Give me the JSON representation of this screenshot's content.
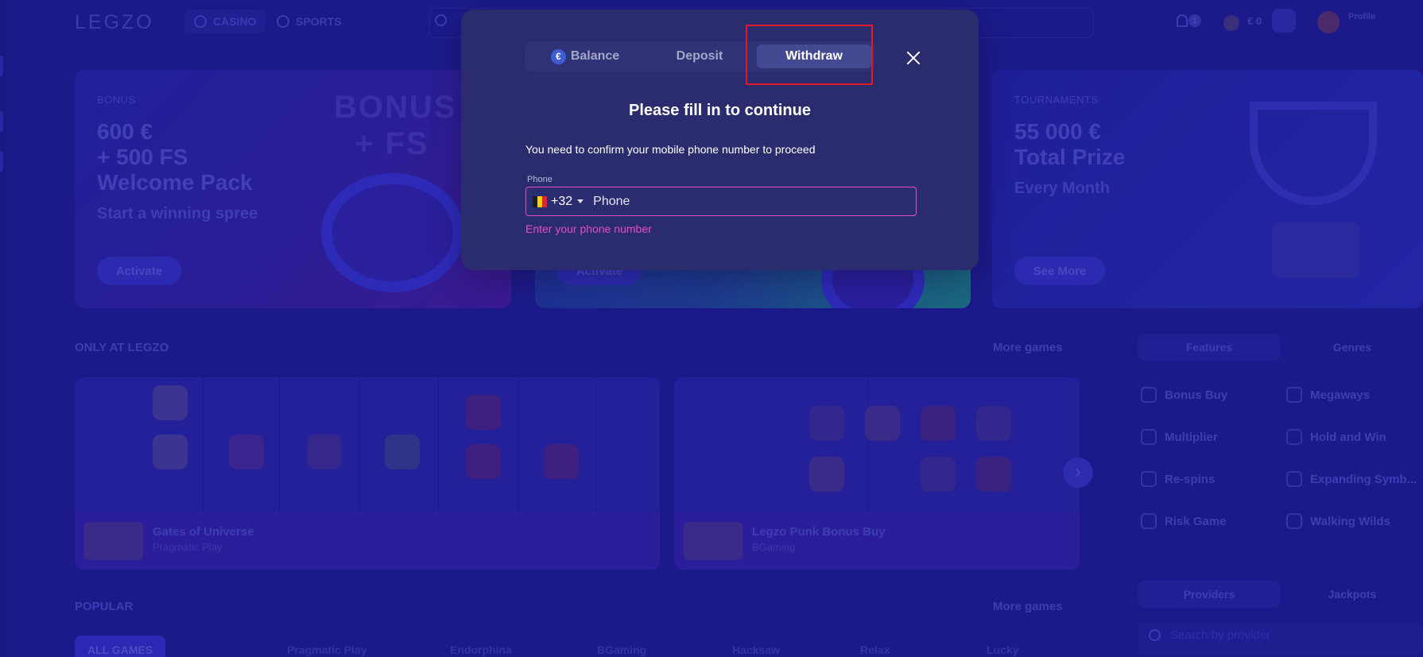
{
  "header": {
    "logo": "LEGZO",
    "nav": [
      {
        "label": "CASINO",
        "icon": "casino-icon"
      },
      {
        "label": "SPORTS",
        "icon": "sports-icon"
      }
    ],
    "notifications_count": "1",
    "balance": "€ 0",
    "profile_label": "Profile"
  },
  "promos": [
    {
      "tag": "BONUS",
      "headline_1": "600 €",
      "headline_2": "+ 500 FS",
      "headline_3": "Welcome Pack",
      "sub": "Start a winning spree",
      "button": "Activate",
      "art": "BONUS",
      "art2": "+ FS"
    },
    {
      "button": "Activate"
    },
    {
      "tag": "TOURNAMENTS",
      "headline_1": "55 000 €",
      "headline_2": "Total Prize",
      "sub": "Every Month",
      "button": "See More"
    }
  ],
  "only_at": {
    "title": "ONLY AT LEGZO",
    "more": "More games",
    "games": [
      {
        "name": "Gates of Universe",
        "provider": "Pragmatic Play"
      },
      {
        "name": "Legzo Punk Bonus Buy",
        "provider": "BGaming"
      }
    ]
  },
  "sidebar": {
    "tabs": [
      "Features",
      "Genres"
    ],
    "features": [
      {
        "label": "Bonus Buy",
        "icon": "bonus-buy-icon"
      },
      {
        "label": "Megaways",
        "icon": "megaways-icon"
      },
      {
        "label": "Multiplier",
        "icon": "diamond-icon"
      },
      {
        "label": "Hold and Win",
        "icon": "dollar-icon"
      },
      {
        "label": "Re-spins",
        "icon": "respin-icon"
      },
      {
        "label": "Expanding Symb...",
        "icon": "expand-icon"
      },
      {
        "label": "Risk Game",
        "icon": "lightning-icon"
      },
      {
        "label": "Walking Wilds",
        "icon": "wilds-icon"
      }
    ],
    "tabs2": [
      "Providers",
      "Jackpots"
    ],
    "provider_search_placeholder": "Search by provider"
  },
  "popular": {
    "title": "POPULAR",
    "more": "More games",
    "chips": [
      "ALL GAMES",
      "Pragmatic Play",
      "Endorphina",
      "BGaming",
      "Hacksaw",
      "Relax",
      "Lucky"
    ]
  },
  "modal": {
    "tabs": [
      "Balance",
      "Deposit",
      "Withdraw"
    ],
    "active_tab": "Withdraw",
    "title": "Please fill in to continue",
    "description": "You need to confirm your mobile phone number to proceed",
    "phone_label": "Phone",
    "country_code": "+32",
    "phone_placeholder": "Phone",
    "error": "Enter your phone number",
    "highlight_color": "#e0182a",
    "error_color": "#e24fc0"
  }
}
